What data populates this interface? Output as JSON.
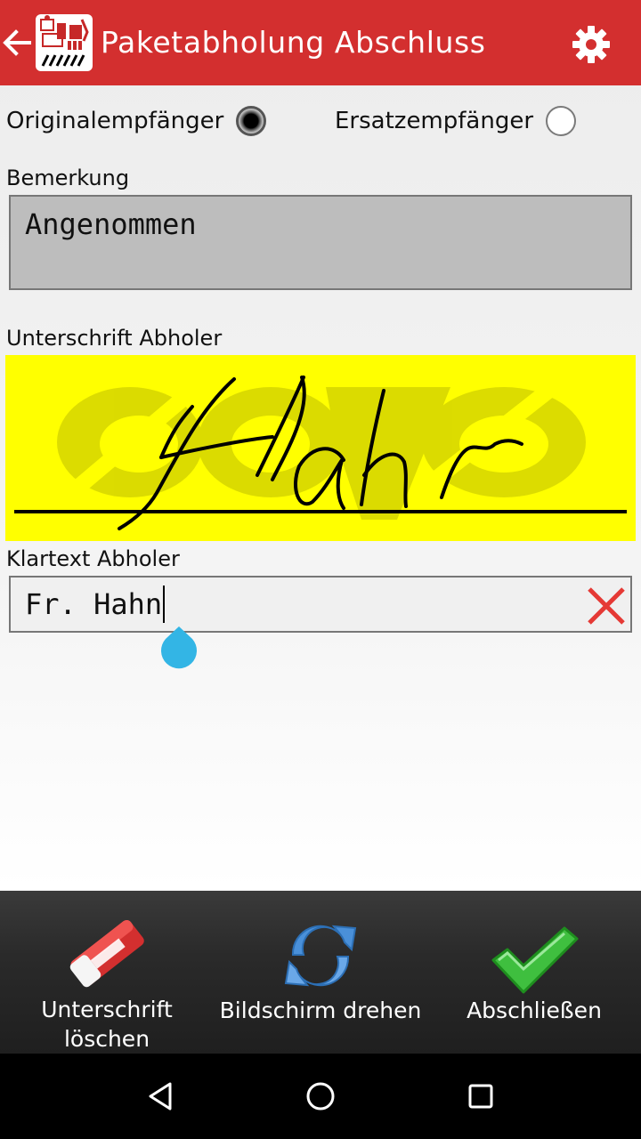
{
  "appbar": {
    "title": "Paketabholung Abschluss",
    "color": "#d32f2f",
    "logo_text": "COSYS",
    "back_icon": "arrow-left-icon",
    "settings_icon": "gear-icon"
  },
  "recipient": {
    "original_label": "Originalempfänger",
    "original_checked": true,
    "substitute_label": "Ersatzempfänger",
    "substitute_checked": false
  },
  "remark": {
    "label": "Bemerkung",
    "value": "Angenommen"
  },
  "signature": {
    "label": "Unterschrift Abholer",
    "watermark_text": "COSYS",
    "background": "#ffff00",
    "signed_text": "Hahn"
  },
  "clear_text": {
    "label": "Klartext Abholer",
    "value": "Fr. Hahn",
    "clear_icon": "close-icon"
  },
  "toolbar": {
    "items": [
      {
        "label_line1": "Unterschrift",
        "label_line2": "löschen",
        "icon": "eraser-icon"
      },
      {
        "label_line1": "Bildschirm drehen",
        "label_line2": "",
        "icon": "rotate-icon"
      },
      {
        "label_line1": "Abschließen",
        "label_line2": "",
        "icon": "checkmark-icon"
      }
    ]
  },
  "navbar": {
    "icons": [
      "back-triangle-icon",
      "home-circle-icon",
      "recents-square-icon"
    ]
  }
}
